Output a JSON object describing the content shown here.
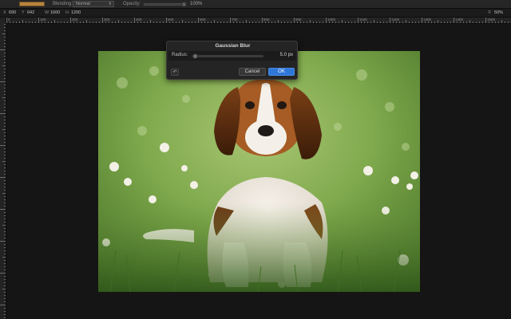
{
  "options_bar": {
    "color_swatch": "#b8843f",
    "blending_label": "Blending:",
    "blending_value": "Normal",
    "opacity_label": "Opacity:",
    "opacity_value": "100%"
  },
  "info_bar": {
    "x_label": "X",
    "x_value": "690",
    "y_label": "Y",
    "y_value": "642",
    "w_label": "W",
    "w_value": "1600",
    "h_label": "H",
    "h_value": "1200",
    "zoom": "50%"
  },
  "ruler": {
    "top_numbers": [
      "0",
      "100",
      "200",
      "300",
      "400",
      "500",
      "600",
      "700",
      "800",
      "900",
      "1000",
      "1100",
      "1200",
      "1300",
      "1400",
      "1500",
      "1600",
      "1700",
      "1800",
      "1900",
      "2000",
      "2100",
      "2200",
      "2300",
      "2400"
    ]
  },
  "dialog": {
    "title": "Gaussian Blur",
    "radius_label": "Radius:",
    "radius_value": "5.0 px",
    "radius_fraction": 0.02,
    "cancel_label": "Cancel",
    "ok_label": "OK"
  },
  "canvas": {
    "image_subject": "beagle-puppy-in-grass-photo"
  }
}
